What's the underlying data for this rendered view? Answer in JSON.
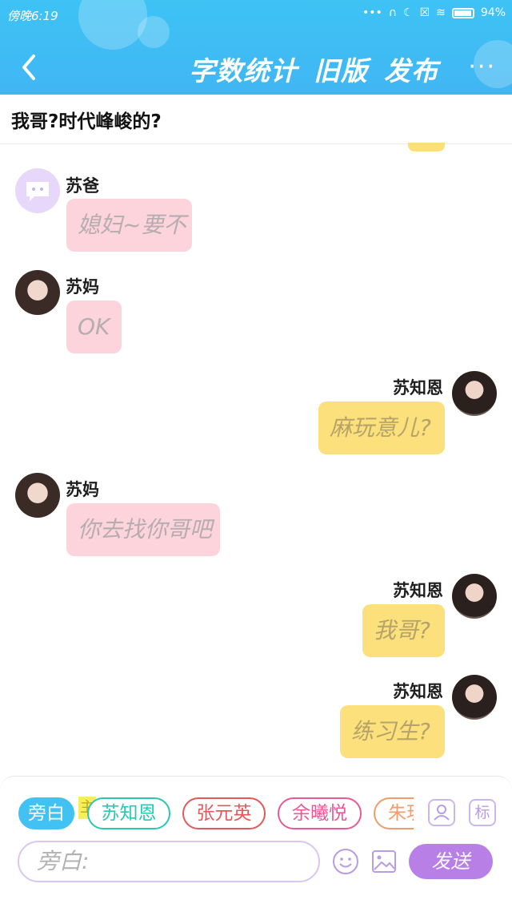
{
  "status_bar": {
    "time": "傍晚6:19",
    "battery": "94%"
  },
  "nav": {
    "actions": [
      "字数统计",
      "旧版",
      "发布"
    ],
    "more": "···"
  },
  "story": {
    "title": "我哥?时代峰峻的?"
  },
  "messages": [
    {
      "side": "left",
      "sender": "苏爸",
      "text": "媳妇~要不",
      "avatar": "chat-bubble-icon"
    },
    {
      "side": "left",
      "sender": "苏妈",
      "text": "OK",
      "avatar": "photo"
    },
    {
      "side": "right",
      "sender": "苏知恩",
      "text": "麻玩意儿?",
      "avatar": "photo"
    },
    {
      "side": "left",
      "sender": "苏妈",
      "text": "你去找你哥吧",
      "avatar": "photo"
    },
    {
      "side": "right",
      "sender": "苏知恩",
      "text": "我哥?",
      "avatar": "photo"
    },
    {
      "side": "right",
      "sender": "苏知恩",
      "text": "练习生?",
      "avatar": "photo"
    }
  ],
  "roles": {
    "main_tag": "主",
    "chips": [
      {
        "label": "旁白",
        "color": "#42c2f3",
        "active": true
      },
      {
        "label": "苏知恩",
        "color": "#2cc6b4",
        "active": false
      },
      {
        "label": "张元英",
        "color": "#e4575a",
        "active": false
      },
      {
        "label": "余曦悦",
        "color": "#e85a96",
        "active": false
      },
      {
        "label": "朱玥",
        "color": "#f19c6e",
        "active": false
      }
    ],
    "tools": [
      "person-icon",
      "标"
    ]
  },
  "composer": {
    "placeholder": "旁白:",
    "send_label": "发送"
  },
  "colors": {
    "header": "#3ec3f5",
    "left_bubble": "#fdd3dc",
    "right_bubble": "#fce07c",
    "send": "#b87fe6"
  }
}
